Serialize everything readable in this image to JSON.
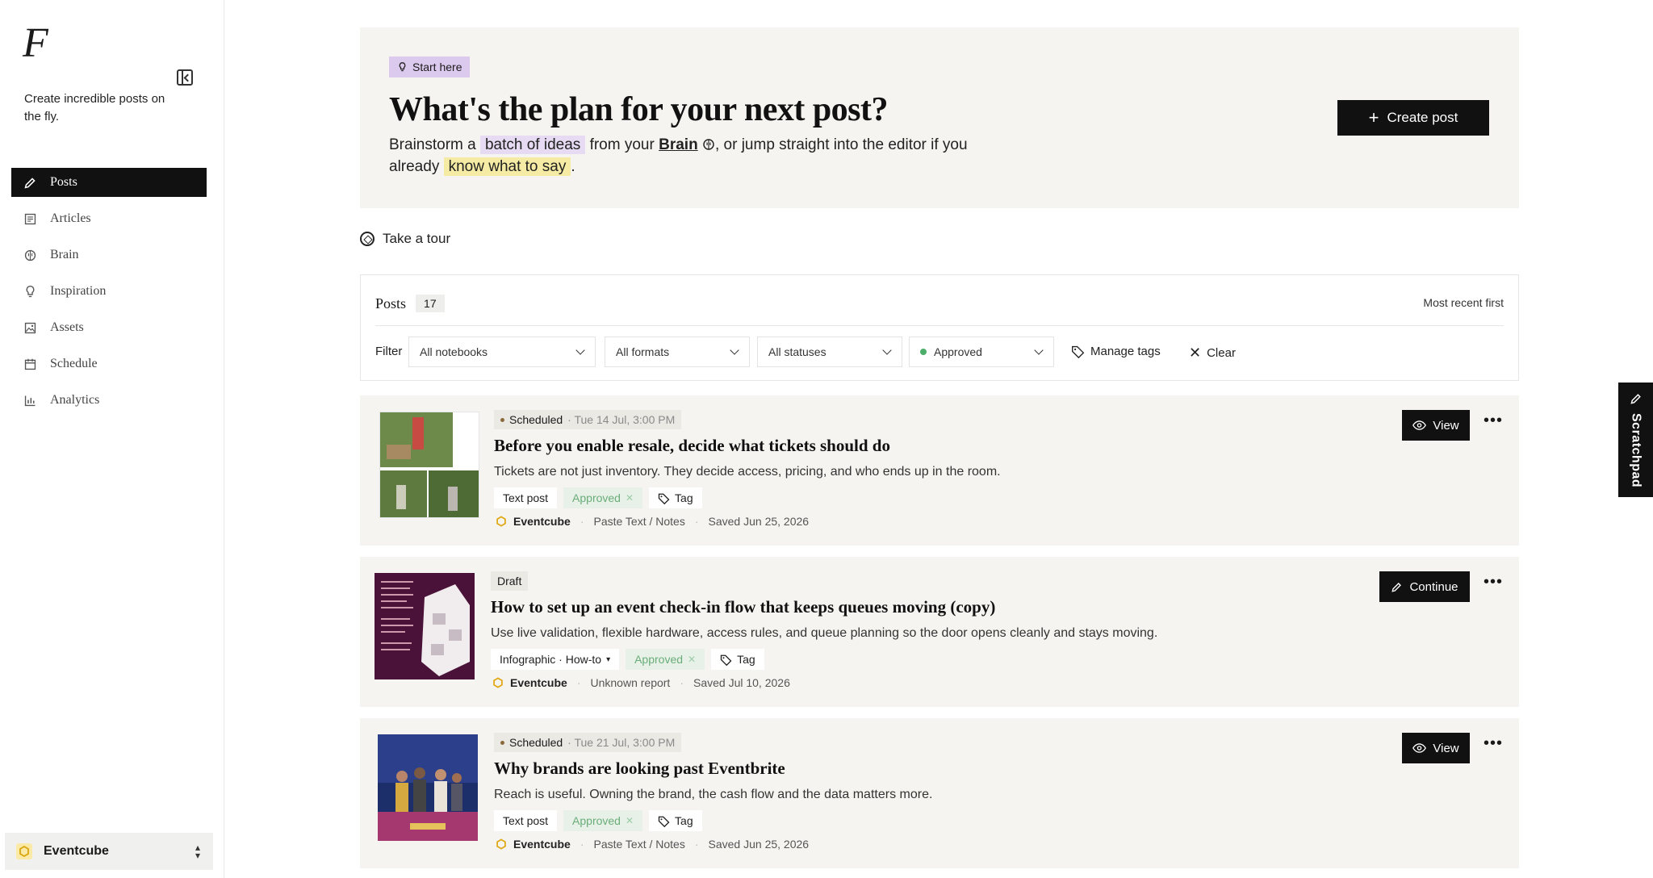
{
  "sidebar": {
    "logo": "F",
    "tagline": "Create incredible posts on the fly.",
    "items": [
      {
        "label": "Posts",
        "icon": "pencil-icon"
      },
      {
        "label": "Articles",
        "icon": "articles-icon"
      },
      {
        "label": "Brain",
        "icon": "brain-icon"
      },
      {
        "label": "Inspiration",
        "icon": "lightbulb-icon"
      },
      {
        "label": "Assets",
        "icon": "image-icon"
      },
      {
        "label": "Schedule",
        "icon": "calendar-icon"
      },
      {
        "label": "Analytics",
        "icon": "bar-chart-icon"
      }
    ],
    "workspace": "Eventcube"
  },
  "hero": {
    "badge": "Start here",
    "title": "What's the plan for your next post?",
    "sub_1": "Brainstorm a ",
    "sub_hl1": "batch of ideas",
    "sub_2": " from your ",
    "sub_brain": "Brain",
    "sub_3": ", or jump straight into the editor if you already ",
    "sub_hl2": "know what to say",
    "sub_4": ".",
    "create_label": "Create post"
  },
  "tour_label": "Take a tour",
  "filters": {
    "title": "Posts",
    "count": "17",
    "sort": "Most recent first",
    "label": "Filter",
    "notebooks": "All notebooks",
    "formats": "All formats",
    "statuses": "All statuses",
    "approval": "Approved",
    "manage_tags": "Manage tags",
    "clear": "Clear"
  },
  "posts": [
    {
      "status": "Scheduled",
      "time": "· Tue 14 Jul, 3:00 PM",
      "title": "Before you enable resale, decide what tickets should do",
      "desc": "Tickets are not just inventory. They decide access, pricing, and who ends up in the room.",
      "format": "Text post",
      "approval": "Approved",
      "tag": "Tag",
      "brand": "Eventcube",
      "source": "Paste Text / Notes",
      "saved": "Saved Jun 25, 2026",
      "action": "View"
    },
    {
      "status": "Draft",
      "time": "",
      "title": "How to set up an event check-in flow that keeps queues moving (copy)",
      "desc": "Use live validation, flexible hardware, access rules, and queue planning so the door opens cleanly and stays moving.",
      "format": "Infographic · How-to",
      "approval": "Approved",
      "tag": "Tag",
      "brand": "Eventcube",
      "source": "Unknown report",
      "saved": "Saved Jul 10, 2026",
      "action": "Continue"
    },
    {
      "status": "Scheduled",
      "time": "· Tue 21 Jul, 3:00 PM",
      "title": "Why brands are looking past Eventbrite",
      "desc": "Reach is useful. Owning the brand, the cash flow and the data matters more.",
      "format": "Text post",
      "approval": "Approved",
      "tag": "Tag",
      "brand": "Eventcube",
      "source": "Paste Text / Notes",
      "saved": "Saved Jun 25, 2026",
      "action": "View"
    }
  ],
  "scratchpad": "Scratchpad",
  "colors": {
    "accent": "#111111",
    "hero_bg": "#f5f4f1",
    "highlight_purple": "#e7dbf3",
    "highlight_yellow": "#f6eba4",
    "approved": "#6aad79"
  }
}
